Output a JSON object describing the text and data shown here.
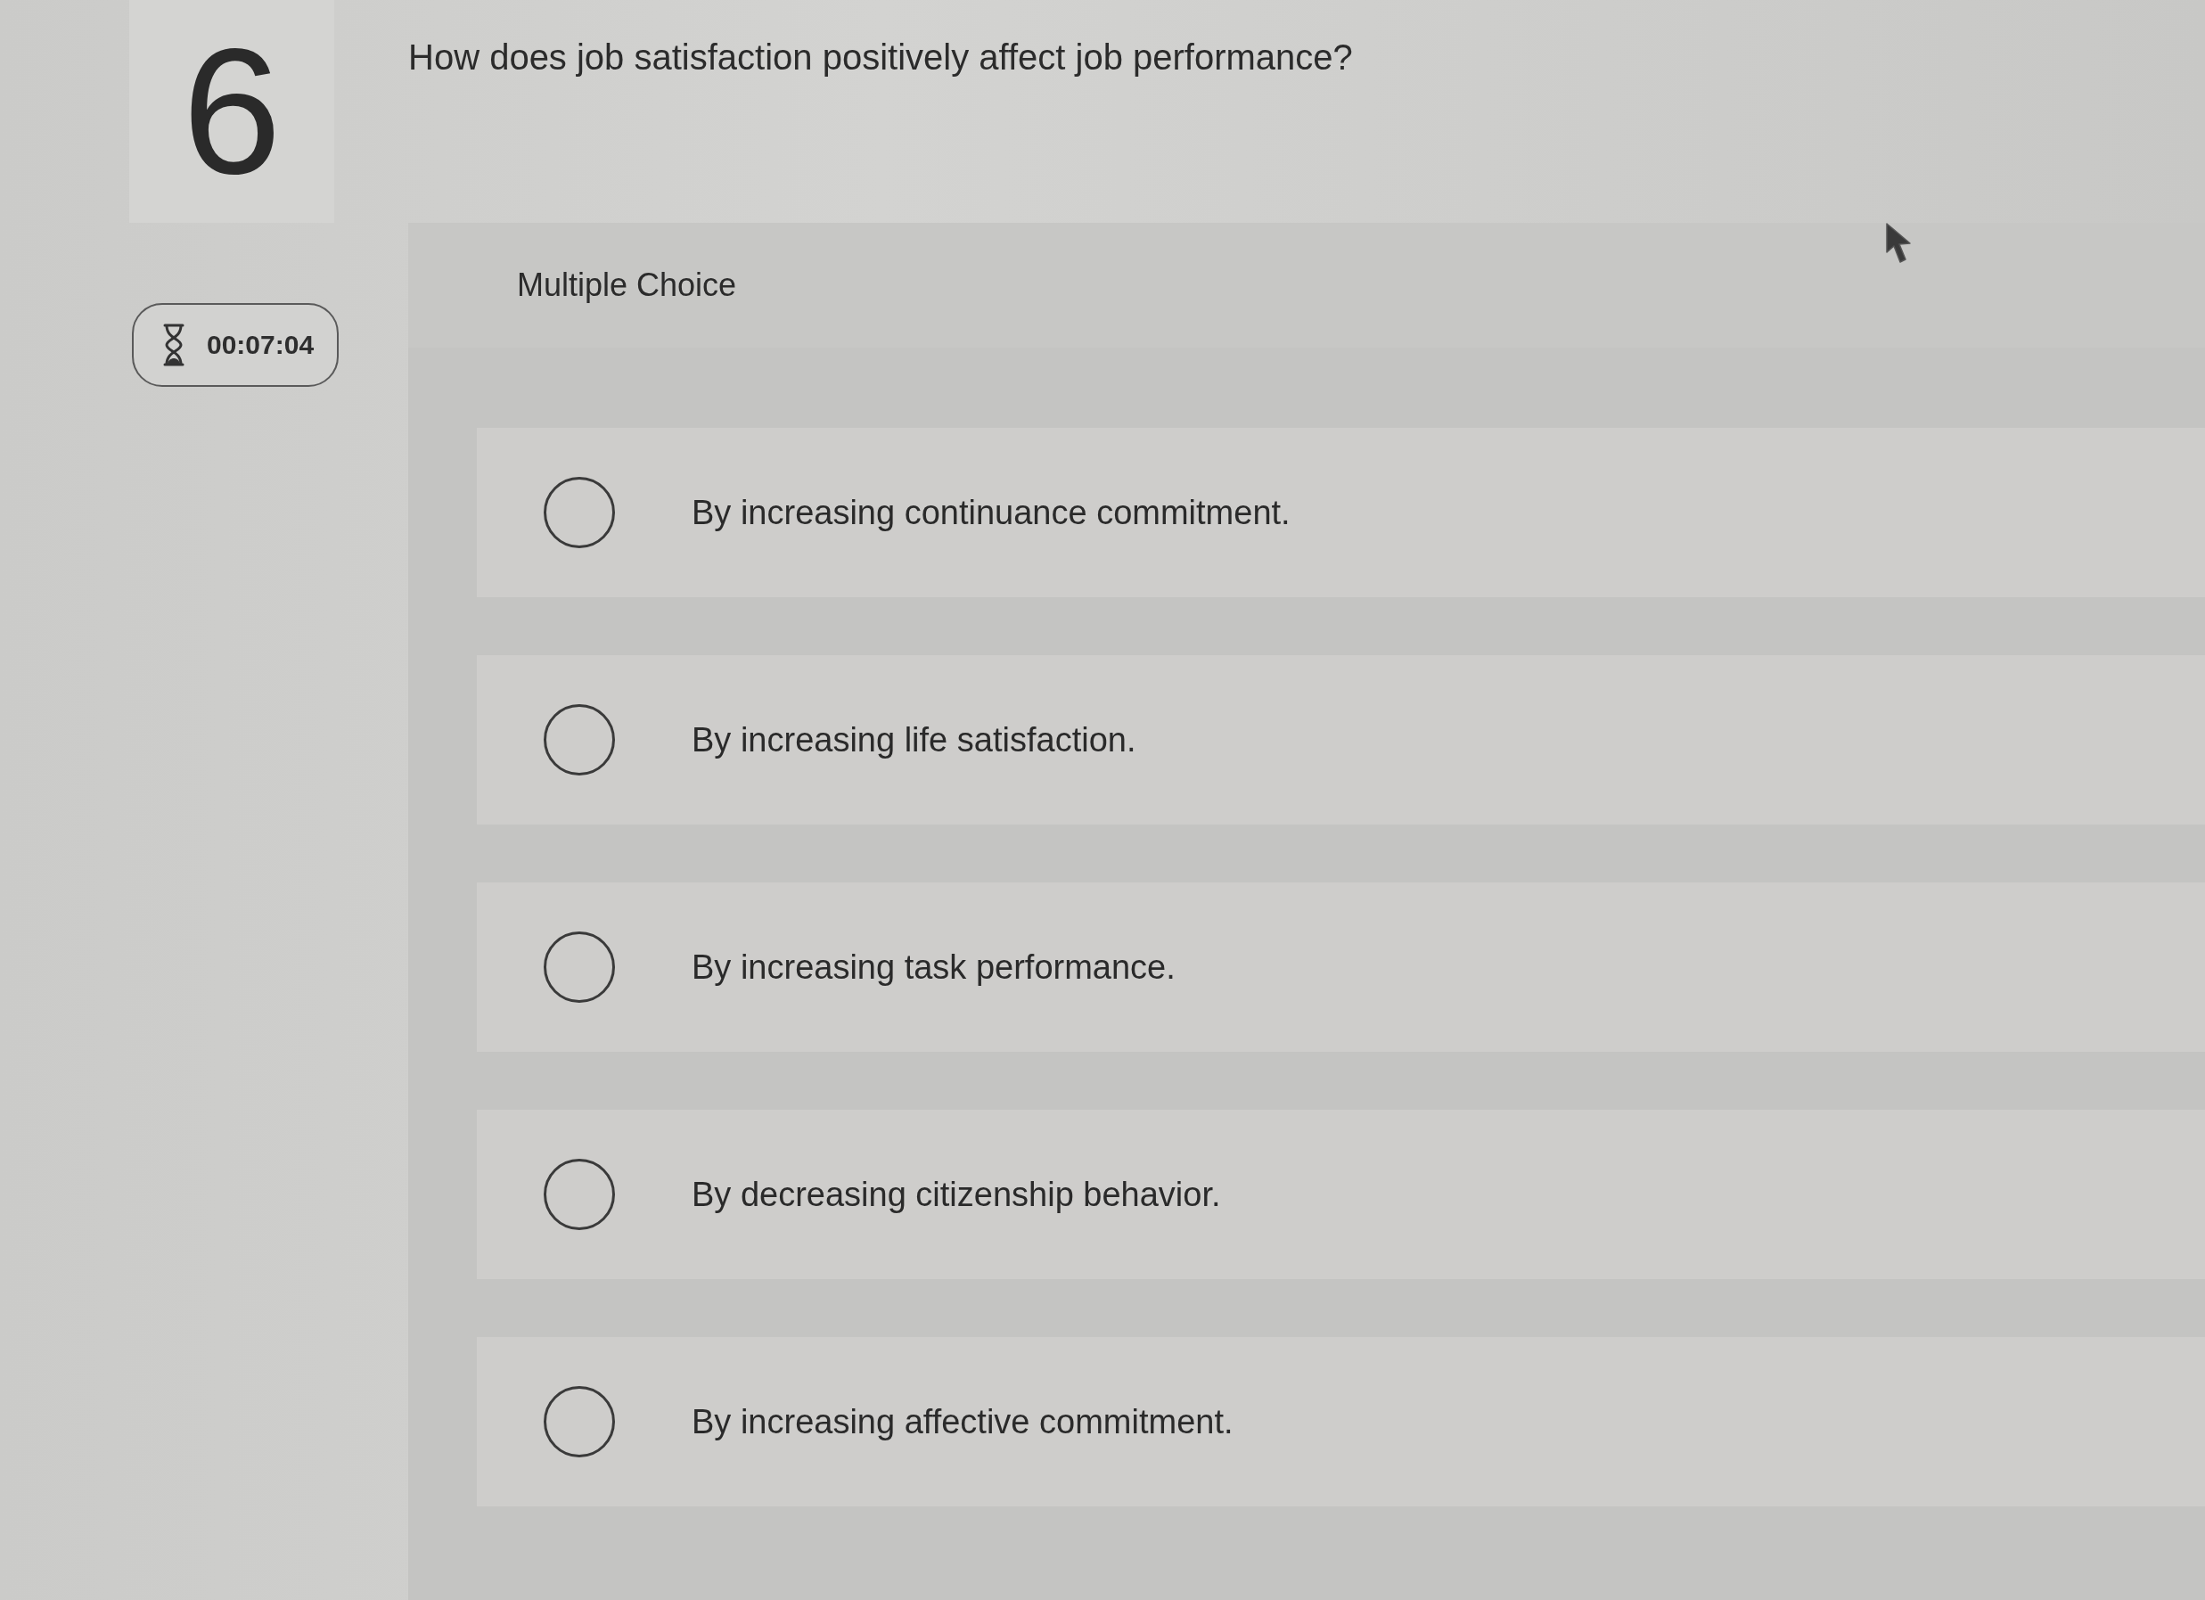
{
  "question": {
    "number": "6",
    "text": "How does job satisfaction positively affect job performance?"
  },
  "timer": {
    "time": "00:07:04"
  },
  "answer_panel": {
    "type_label": "Multiple Choice",
    "options": [
      {
        "label": "By increasing continuance commitment.",
        "selected": false
      },
      {
        "label": "By increasing life satisfaction.",
        "selected": false
      },
      {
        "label": "By increasing task performance.",
        "selected": false
      },
      {
        "label": "By decreasing citizenship behavior.",
        "selected": false
      },
      {
        "label": "By increasing affective commitment.",
        "selected": false
      }
    ]
  }
}
